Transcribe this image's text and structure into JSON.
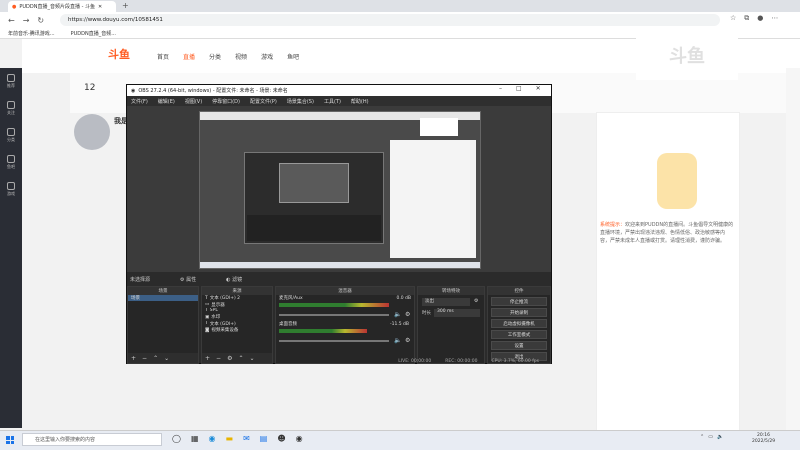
{
  "browser": {
    "tab_title": "PUDDN直播_音频片段直播 - 斗鱼",
    "url": "https://www.douyu.com/10581451",
    "bookmarks": [
      "年前音乐-腾讯游戏...",
      "PUDDN直播_音频..."
    ]
  },
  "douyu": {
    "logo": "斗鱼",
    "nav": [
      "首页",
      "直播",
      "分类",
      "视频",
      "游戏",
      "鱼吧"
    ],
    "follow_count": "12",
    "room_title": "我是",
    "sidebar": [
      "推荐",
      "关注",
      "分类",
      "鱼吧",
      "游戏"
    ],
    "notice_label": "系统提示：",
    "notice_text": "欢迎来到PUDDN的直播间。斗鱼倡导文明健康的直播环境，严禁出现违法违规、色情低俗、政治敏感等内容，严禁未成年人直播或打赏。请理性消费，谨防诈骗。",
    "watermark": "斗鱼"
  },
  "obs": {
    "title": "OBS 27.2.4 (64-bit, windows) - 配置文件: 未命名 - 场景: 未命名",
    "menu": [
      "文件(F)",
      "编辑(E)",
      "视图(V)",
      "停靠窗口(D)",
      "配置文件(P)",
      "场景集合(S)",
      "工具(T)",
      "帮助(H)"
    ],
    "source_label": "未选择源",
    "prop_btn": "属性",
    "filter_btn": "滤镜",
    "docks": {
      "scenes": {
        "title": "场景",
        "items": [
          "场景"
        ]
      },
      "sources": {
        "title": "来源",
        "items": [
          "文本 (GDI+) 2",
          "显示器",
          "SPL",
          "水印",
          "文本 (GDI+)",
          "视频采集设备"
        ]
      },
      "mixer": {
        "title": "混音器",
        "tracks": [
          {
            "name": "麦克风/Aux",
            "db": "0.0 dB"
          },
          {
            "name": "桌面音频",
            "db": "-11.5 dB"
          }
        ]
      },
      "transitions": {
        "title": "转场特效",
        "type": "淡出",
        "duration_label": "时长",
        "duration": "300 ms"
      },
      "controls": {
        "title": "控件",
        "buttons": [
          "停止推流",
          "开始录制",
          "启动虚拟摄像机",
          "工作室模式",
          "设置",
          "退出"
        ]
      }
    },
    "status": {
      "live": "LIVE: 00:00:00",
      "rec": "REC: 00:00:00",
      "cpu": "CPU: 3.7%, 60.00 fps"
    }
  },
  "taskbar": {
    "search_placeholder": "在这里输入你要搜索的内容",
    "time": "20:16",
    "date": "2022/5/29"
  }
}
